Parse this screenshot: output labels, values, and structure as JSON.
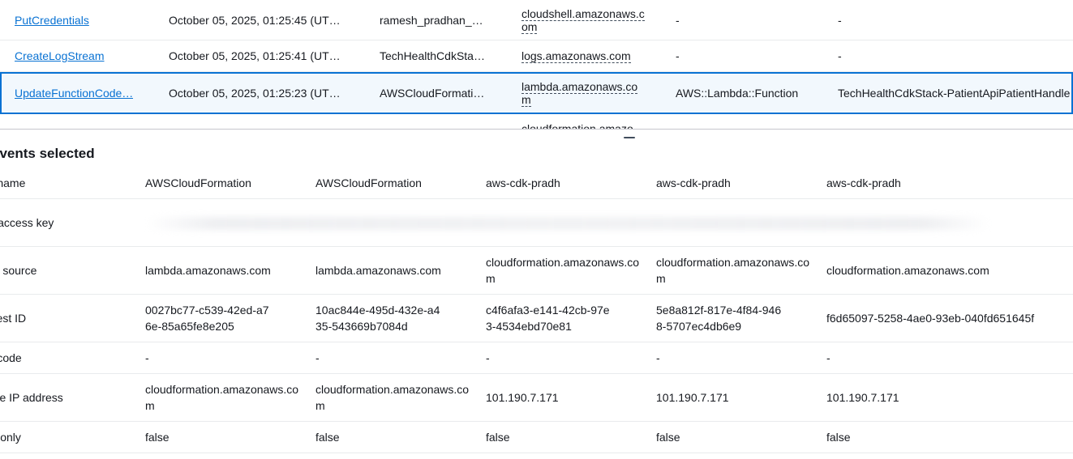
{
  "events": [
    {
      "name": "PutCredentials",
      "time": "October 05, 2025, 01:25:45 (UT…",
      "user": "ramesh_pradhan_…",
      "source": "cloudshell.amazonaws.com",
      "resource_type": "-",
      "resource_name": "-"
    },
    {
      "name": "CreateLogStream",
      "time": "October 05, 2025, 01:25:41 (UT…",
      "user": "TechHealthCdkSta…",
      "source": "logs.amazonaws.com",
      "resource_type": "-",
      "resource_name": "-"
    },
    {
      "name": "UpdateFunctionCode…",
      "time": "October 05, 2025, 01:25:23 (UT…",
      "user": "AWSCloudFormation",
      "source": "lambda.amazonaws.com",
      "resource_type": "AWS::Lambda::Function",
      "resource_name": "TechHealthCdkStack-PatientApiPatientHandle"
    },
    {
      "name": "",
      "time": "",
      "user": "",
      "source": "cloudformation.amazo",
      "resource_type": "",
      "resource_name": ""
    }
  ],
  "panel": {
    "title": "events selected",
    "rows": [
      {
        "label": "er name",
        "values": [
          "AWSCloudFormation",
          "AWSCloudFormation",
          "aws-cdk-pradh",
          "aws-cdk-pradh",
          "aws-cdk-pradh"
        ]
      },
      {
        "label": "/S access key",
        "values": [
          "",
          "",
          "",
          "",
          ""
        ]
      },
      {
        "label": "ent source",
        "values": [
          "lambda.amazonaws.com",
          "lambda.amazonaws.com",
          "cloudformation.amazonaws.com",
          "cloudformation.amazonaws.com",
          "cloudformation.amazonaws.com"
        ]
      },
      {
        "label": "quest ID",
        "values": [
          "0027bc77-c539-42ed-a76e-85a65fe8e205",
          "10ac844e-495d-432e-a435-543669b7084d",
          "c4f6afa3-e141-42cb-97e3-4534ebd70e81",
          "5e8a812f-817e-4f84-9468-5707ec4db6e9",
          "f6d65097-5258-4ae0-93eb-040fd651645f"
        ]
      },
      {
        "label": "or code",
        "values": [
          "-",
          "-",
          "-",
          "-",
          "-"
        ]
      },
      {
        "label": "urce IP address",
        "values": [
          "cloudformation.amazonaws.com",
          "cloudformation.amazonaws.com",
          "101.190.7.171",
          "101.190.7.171",
          "101.190.7.171"
        ]
      },
      {
        "label": "ad-only",
        "values": [
          "false",
          "false",
          "false",
          "false",
          "false"
        ]
      }
    ]
  },
  "colors": {
    "link": "#0972d3",
    "selected_bg": "#f2f8fd",
    "selected_border": "#0972d3"
  }
}
